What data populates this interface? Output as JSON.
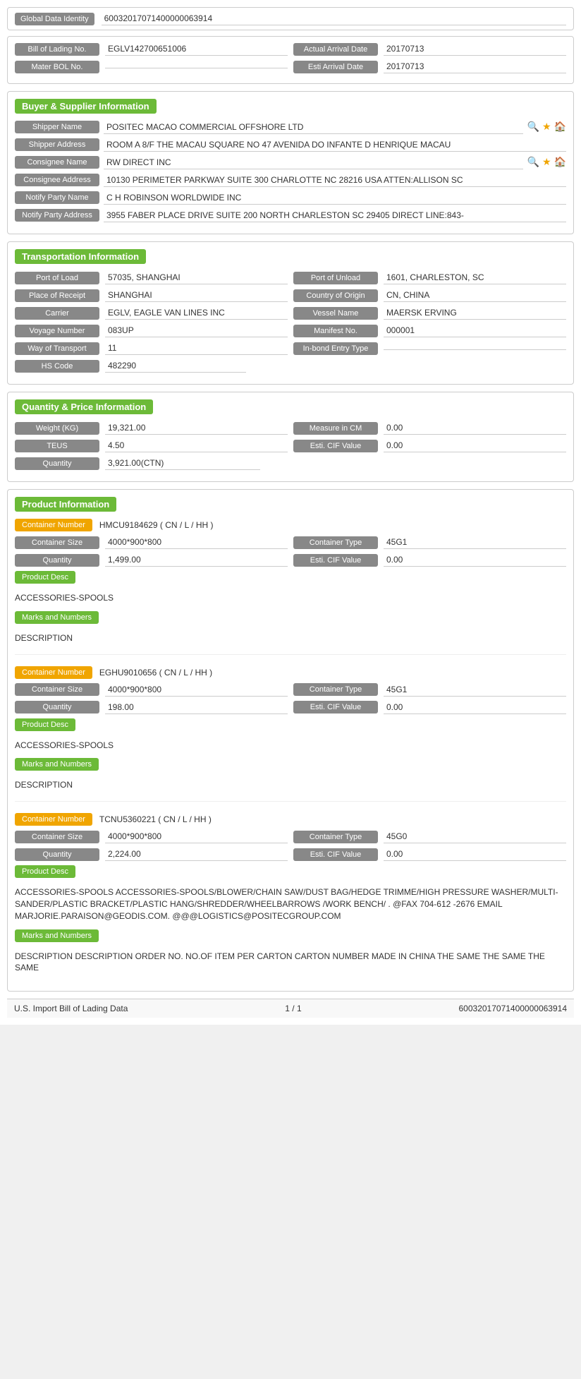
{
  "global": {
    "label": "Global Data Identity",
    "value": "60032017071400000063914"
  },
  "header": {
    "bol_label": "Bill of Lading No.",
    "bol_value": "EGLV142700651006",
    "actual_arrival_label": "Actual Arrival Date",
    "actual_arrival_value": "20170713",
    "mater_bol_label": "Mater BOL No.",
    "mater_bol_value": "",
    "esti_arrival_label": "Esti Arrival Date",
    "esti_arrival_value": "20170713"
  },
  "buyer_supplier": {
    "section_title": "Buyer & Supplier Information",
    "shipper_name_label": "Shipper Name",
    "shipper_name_value": "POSITEC MACAO COMMERCIAL OFFSHORE LTD",
    "shipper_address_label": "Shipper Address",
    "shipper_address_value": "ROOM A 8/F THE MACAU SQUARE NO 47 AVENIDA DO INFANTE D HENRIQUE MACAU",
    "consignee_name_label": "Consignee Name",
    "consignee_name_value": "RW DIRECT INC",
    "consignee_address_label": "Consignee Address",
    "consignee_address_value": "10130 PERIMETER PARKWAY SUITE 300 CHARLOTTE NC 28216 USA ATTEN:ALLISON SC",
    "notify_party_name_label": "Notify Party Name",
    "notify_party_name_value": "C H ROBINSON WORLDWIDE INC",
    "notify_party_address_label": "Notify Party Address",
    "notify_party_address_value": "3955 FABER PLACE DRIVE SUITE 200 NORTH CHARLESTON SC 29405 DIRECT LINE:843-"
  },
  "transportation": {
    "section_title": "Transportation Information",
    "port_of_load_label": "Port of Load",
    "port_of_load_value": "57035, SHANGHAI",
    "port_of_unload_label": "Port of Unload",
    "port_of_unload_value": "1601, CHARLESTON, SC",
    "place_of_receipt_label": "Place of Receipt",
    "place_of_receipt_value": "SHANGHAI",
    "country_of_origin_label": "Country of Origin",
    "country_of_origin_value": "CN, CHINA",
    "carrier_label": "Carrier",
    "carrier_value": "EGLV, EAGLE VAN LINES INC",
    "vessel_name_label": "Vessel Name",
    "vessel_name_value": "MAERSK ERVING",
    "voyage_number_label": "Voyage Number",
    "voyage_number_value": "083UP",
    "manifest_no_label": "Manifest No.",
    "manifest_no_value": "000001",
    "way_of_transport_label": "Way of Transport",
    "way_of_transport_value": "11",
    "in_bond_label": "In-bond Entry Type",
    "in_bond_value": "",
    "hs_code_label": "HS Code",
    "hs_code_value": "482290"
  },
  "quantity_price": {
    "section_title": "Quantity & Price Information",
    "weight_label": "Weight (KG)",
    "weight_value": "19,321.00",
    "measure_label": "Measure in CM",
    "measure_value": "0.00",
    "teus_label": "TEUS",
    "teus_value": "4.50",
    "esti_cif_label": "Esti. CIF Value",
    "esti_cif_value": "0.00",
    "quantity_label": "Quantity",
    "quantity_value": "3,921.00(CTN)"
  },
  "product_information": {
    "section_title": "Product Information",
    "containers": [
      {
        "container_number_label": "Container Number",
        "container_number_value": "HMCU9184629 ( CN / L / HH )",
        "container_size_label": "Container Size",
        "container_size_value": "4000*900*800",
        "container_type_label": "Container Type",
        "container_type_value": "45G1",
        "quantity_label": "Quantity",
        "quantity_value": "1,499.00",
        "esti_cif_label": "Esti. CIF Value",
        "esti_cif_value": "0.00",
        "product_desc_label": "Product Desc",
        "product_desc_value": "ACCESSORIES-SPOOLS",
        "marks_numbers_label": "Marks and Numbers",
        "marks_numbers_value": "DESCRIPTION"
      },
      {
        "container_number_label": "Container Number",
        "container_number_value": "EGHU9010656 ( CN / L / HH )",
        "container_size_label": "Container Size",
        "container_size_value": "4000*900*800",
        "container_type_label": "Container Type",
        "container_type_value": "45G1",
        "quantity_label": "Quantity",
        "quantity_value": "198.00",
        "esti_cif_label": "Esti. CIF Value",
        "esti_cif_value": "0.00",
        "product_desc_label": "Product Desc",
        "product_desc_value": "ACCESSORIES-SPOOLS",
        "marks_numbers_label": "Marks and Numbers",
        "marks_numbers_value": "DESCRIPTION"
      },
      {
        "container_number_label": "Container Number",
        "container_number_value": "TCNU5360221 ( CN / L / HH )",
        "container_size_label": "Container Size",
        "container_size_value": "4000*900*800",
        "container_type_label": "Container Type",
        "container_type_value": "45G0",
        "quantity_label": "Quantity",
        "quantity_value": "2,224.00",
        "esti_cif_label": "Esti. CIF Value",
        "esti_cif_value": "0.00",
        "product_desc_label": "Product Desc",
        "product_desc_value": "ACCESSORIES-SPOOLS ACCESSORIES-SPOOLS/BLOWER/CHAIN SAW/DUST BAG/HEDGE TRIMME/HIGH PRESSURE WASHER/MULTI-SANDER/PLASTIC BRACKET/PLASTIC HANG/SHREDDER/WHEELBARROWS /WORK BENCH/ . @FAX 704-612 -2676 EMAIL MARJORIE.PARAISON@GEODIS.COM. @@@LOGISTICS@POSITECGROUP.COM",
        "marks_numbers_label": "Marks and Numbers",
        "marks_numbers_value": "DESCRIPTION DESCRIPTION ORDER NO. NO.OF ITEM PER CARTON CARTON NUMBER MADE IN CHINA THE SAME THE SAME THE SAME"
      }
    ]
  },
  "footer": {
    "left": "U.S. Import Bill of Lading Data",
    "center": "1 / 1",
    "right": "60032017071400000063914"
  }
}
